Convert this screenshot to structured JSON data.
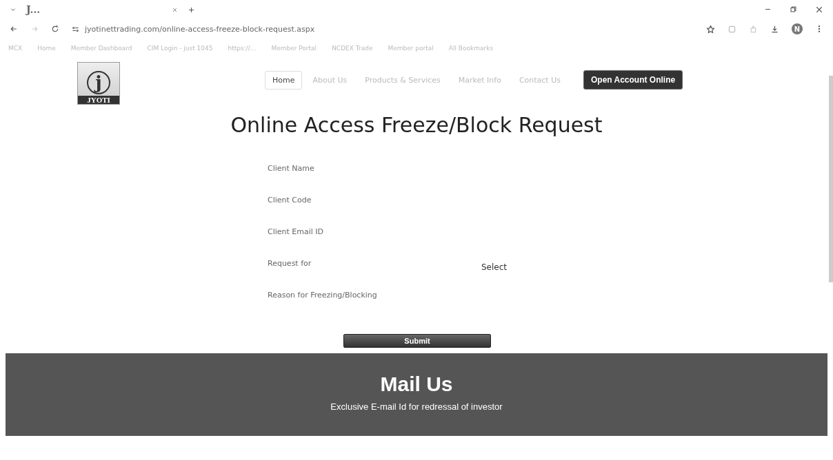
{
  "browser": {
    "tab_title": "J...",
    "url": "jyotinettrading.com/online-access-freeze-block-request.aspx",
    "profile_initial": "N",
    "bookmarks": [
      {
        "label": "MCX"
      },
      {
        "label": "Home"
      },
      {
        "label": "Member Dashboard"
      },
      {
        "label": "CIM Login - just 1045"
      },
      {
        "label": "https://..."
      },
      {
        "label": "Member Portal"
      },
      {
        "label": "NCDEX Trade"
      },
      {
        "label": "Member portal"
      },
      {
        "label": "All Bookmarks"
      }
    ]
  },
  "site": {
    "logo_text": "JYOTI",
    "logo_letter": "j",
    "nav": [
      {
        "label": "Home",
        "selected": true
      },
      {
        "label": "About Us",
        "selected": false
      },
      {
        "label": "Products & Services",
        "selected": false
      },
      {
        "label": "Market Info",
        "selected": false
      },
      {
        "label": "Contact Us",
        "selected": false
      }
    ],
    "cta": "Open Account Online"
  },
  "form": {
    "title": "Online Access Freeze/Block Request",
    "fields": [
      {
        "label": "Client Name",
        "kind": "text"
      },
      {
        "label": "Client Code",
        "kind": "text"
      },
      {
        "label": "Client Email ID",
        "kind": "text"
      },
      {
        "label": "Request for",
        "kind": "select",
        "value": "Select"
      },
      {
        "label": "Reason for Freezing/Blocking",
        "kind": "textarea"
      }
    ],
    "submit": "Submit"
  },
  "footer": {
    "title": "Mail Us",
    "subtitle": "Exclusive E-mail Id for redressal of investor"
  }
}
